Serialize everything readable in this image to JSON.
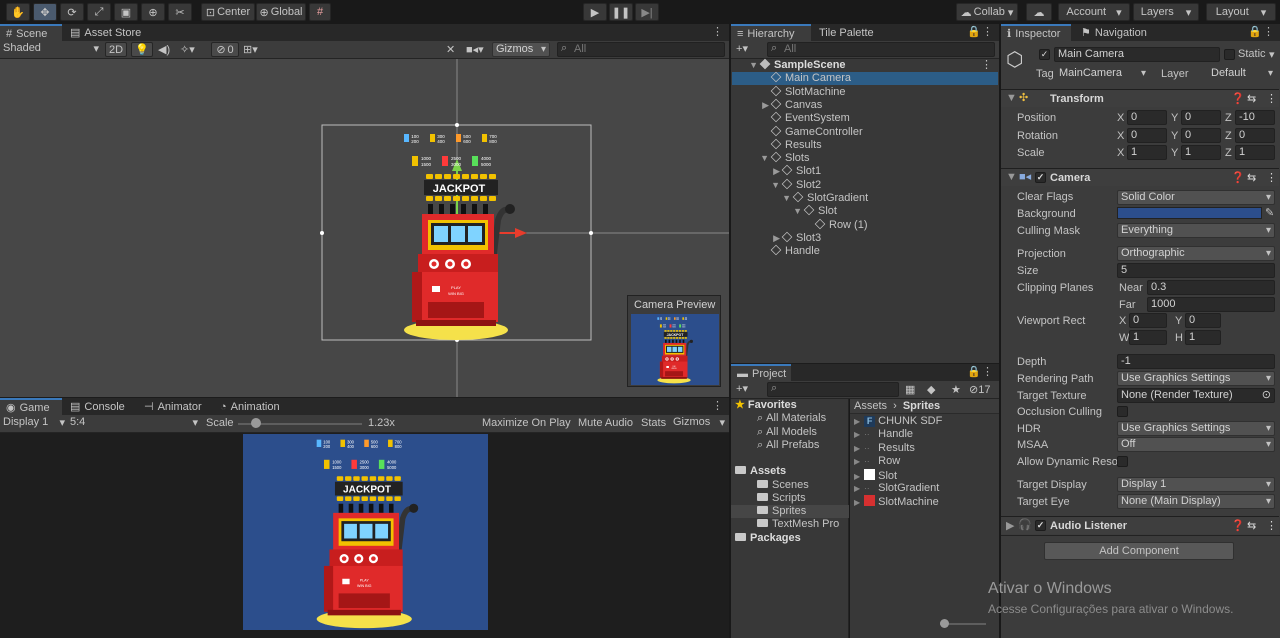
{
  "toolbar": {
    "tools": [
      {
        "name": "hand-tool-icon",
        "glyph": "✋"
      },
      {
        "name": "move-tool-icon",
        "glyph": "✥"
      },
      {
        "name": "rotate-tool-icon",
        "glyph": "⟳"
      },
      {
        "name": "scale-tool-icon",
        "glyph": "⤢"
      },
      {
        "name": "rect-tool-icon",
        "glyph": "▣"
      },
      {
        "name": "transform-tool-icon",
        "glyph": "⊕"
      },
      {
        "name": "custom-tool-icon",
        "glyph": "✂"
      }
    ],
    "pivot_label": "Center",
    "space_label": "Global",
    "collab_label": "Collab",
    "account_label": "Account",
    "layers_label": "Layers",
    "layout_label": "Layout"
  },
  "scene": {
    "tabs": [
      "Scene",
      "Asset Store"
    ],
    "shading_mode": "Shaded",
    "mode_2d": "2D",
    "hidden_count": "0",
    "gizmos_label": "Gizmos",
    "search_placeholder": "All",
    "camera_preview_title": "Camera Preview"
  },
  "game": {
    "tabs": [
      "Game",
      "Console",
      "Animator",
      "Animation"
    ],
    "display": "Display 1",
    "aspect": "5:4",
    "scale_label": "Scale",
    "scale_value": "1.23x",
    "maximize_label": "Maximize On Play",
    "mute_label": "Mute Audio",
    "stats_label": "Stats",
    "gizmos_label": "Gizmos"
  },
  "machine": {
    "payouts_row1": [
      "100\n200",
      "300\n400",
      "500\n600",
      "700\n800"
    ],
    "payouts_row2": [
      "1000\n1500",
      "2500\n3000",
      "4000\n5000"
    ],
    "jackpot_label": "JACKPOT",
    "base_text": "PLAY\nWIN BIG"
  },
  "hierarchy": {
    "tabs": [
      "Hierarchy",
      "Tile Palette"
    ],
    "search_placeholder": "All",
    "items": [
      {
        "label": "SampleScene",
        "depth": 0,
        "arrow": "▼",
        "scene": true
      },
      {
        "label": "Main Camera",
        "depth": 1,
        "arrow": "",
        "selected": true
      },
      {
        "label": "SlotMachine",
        "depth": 1,
        "arrow": ""
      },
      {
        "label": "Canvas",
        "depth": 1,
        "arrow": "▶"
      },
      {
        "label": "EventSystem",
        "depth": 1,
        "arrow": ""
      },
      {
        "label": "GameController",
        "depth": 1,
        "arrow": ""
      },
      {
        "label": "Results",
        "depth": 1,
        "arrow": ""
      },
      {
        "label": "Slots",
        "depth": 1,
        "arrow": "▼"
      },
      {
        "label": "Slot1",
        "depth": 2,
        "arrow": "▶"
      },
      {
        "label": "Slot2",
        "depth": 2,
        "arrow": "▼"
      },
      {
        "label": "SlotGradient",
        "depth": 3,
        "arrow": "▼"
      },
      {
        "label": "Slot",
        "depth": 4,
        "arrow": "▼"
      },
      {
        "label": "Row (1)",
        "depth": 5,
        "arrow": ""
      },
      {
        "label": "Slot3",
        "depth": 2,
        "arrow": "▶"
      },
      {
        "label": "Handle",
        "depth": 1,
        "arrow": ""
      }
    ]
  },
  "project": {
    "tab": "Project",
    "hidden_count": "17",
    "favorites_label": "Favorites",
    "favorites": [
      "All Materials",
      "All Models",
      "All Prefabs"
    ],
    "assets_label": "Assets",
    "asset_folders": [
      "Scenes",
      "Scripts",
      "Sprites",
      "TextMesh Pro"
    ],
    "packages_label": "Packages",
    "breadcrumb": [
      "Assets",
      "Sprites"
    ],
    "files": [
      {
        "label": "CHUNK SDF",
        "icon": "font-icon"
      },
      {
        "label": "Handle",
        "icon": "sprite-icon"
      },
      {
        "label": "Results",
        "icon": "sprite-icon"
      },
      {
        "label": "Row",
        "icon": "sprite-icon"
      },
      {
        "label": "Slot",
        "icon": "white-sprite-icon"
      },
      {
        "label": "SlotGradient",
        "icon": "sprite-icon"
      },
      {
        "label": "SlotMachine",
        "icon": "slot-machine-sprite-icon"
      }
    ]
  },
  "inspector": {
    "tabs": [
      "Inspector",
      "Navigation"
    ],
    "object_name": "Main Camera",
    "static_label": "Static",
    "tag_label": "Tag",
    "tag_value": "MainCamera",
    "layer_label": "Layer",
    "layer_value": "Default",
    "transform": {
      "title": "Transform",
      "position_label": "Position",
      "position": {
        "x": "0",
        "y": "0",
        "z": "-10"
      },
      "rotation_label": "Rotation",
      "rotation": {
        "x": "0",
        "y": "0",
        "z": "0"
      },
      "scale_label": "Scale",
      "scale": {
        "x": "1",
        "y": "1",
        "z": "1"
      }
    },
    "camera": {
      "title": "Camera",
      "clear_flags_label": "Clear Flags",
      "clear_flags": "Solid Color",
      "background_label": "Background",
      "background_color": "#2c4e8c",
      "culling_mask_label": "Culling Mask",
      "culling_mask": "Everything",
      "projection_label": "Projection",
      "projection": "Orthographic",
      "size_label": "Size",
      "size": "5",
      "clipping_label": "Clipping Planes",
      "near_label": "Near",
      "near": "0.3",
      "far_label": "Far",
      "far": "1000",
      "viewport_label": "Viewport Rect",
      "vx": "0",
      "vy": "0",
      "vw": "1",
      "vh": "1",
      "depth_label": "Depth",
      "depth": "-1",
      "rendering_path_label": "Rendering Path",
      "rendering_path": "Use Graphics Settings",
      "target_texture_label": "Target Texture",
      "target_texture": "None (Render Texture)",
      "occlusion_label": "Occlusion Culling",
      "hdr_label": "HDR",
      "hdr": "Use Graphics Settings",
      "msaa_label": "MSAA",
      "msaa": "Off",
      "dynamic_res_label": "Allow Dynamic Reso",
      "target_display_label": "Target Display",
      "target_display": "Display 1",
      "target_eye_label": "Target Eye",
      "target_eye": "None (Main Display)"
    },
    "audio_listener_title": "Audio Listener",
    "add_component_label": "Add Component"
  },
  "watermark": {
    "title": "Ativar o Windows",
    "subtitle": "Acesse Configurações para ativar o Windows."
  },
  "colors": {
    "accent": "#3a79bb",
    "selection": "#2c5d87",
    "game_bg": "#2c4e8c",
    "machine_red": "#e02a2a",
    "gold": "#f2c200"
  }
}
